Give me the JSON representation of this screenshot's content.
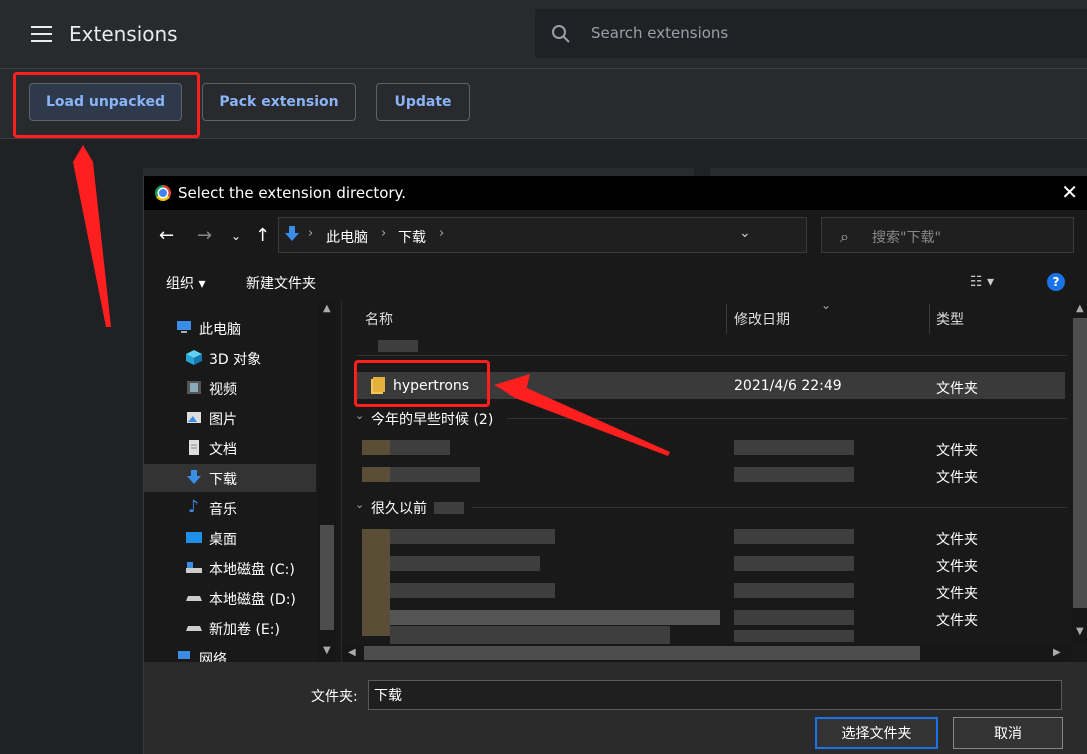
{
  "header": {
    "title": "Extensions",
    "search_placeholder": "Search extensions"
  },
  "toolbar": {
    "load_unpacked": "Load unpacked",
    "pack_extension": "Pack extension",
    "update": "Update"
  },
  "dialog": {
    "title": "Select the extension directory.",
    "close": "✕",
    "address": {
      "crumbs": [
        "此电脑",
        "下载"
      ]
    },
    "search_placeholder": "搜索\"下载\"",
    "commands": {
      "organize": "组织 ▾",
      "new_folder": "新建文件夹",
      "help": "?"
    },
    "nav_tree": [
      {
        "label": "此电脑",
        "icon": "computer-icon"
      },
      {
        "label": "3D 对象",
        "icon": "3d-objects-icon"
      },
      {
        "label": "视频",
        "icon": "video-icon"
      },
      {
        "label": "图片",
        "icon": "pictures-icon"
      },
      {
        "label": "文档",
        "icon": "documents-icon"
      },
      {
        "label": "下载",
        "icon": "download-icon",
        "selected": true
      },
      {
        "label": "音乐",
        "icon": "music-icon"
      },
      {
        "label": "桌面",
        "icon": "desktop-icon"
      },
      {
        "label": "本地磁盘 (C:)",
        "icon": "drive-c-icon"
      },
      {
        "label": "本地磁盘 (D:)",
        "icon": "drive-d-icon"
      },
      {
        "label": "新加卷 (E:)",
        "icon": "drive-e-icon"
      },
      {
        "label": "网络",
        "icon": "network-icon"
      }
    ],
    "columns": {
      "name": "名称",
      "modified": "修改日期",
      "type": "类型"
    },
    "selected_item": {
      "name": "hypertrons",
      "modified": "2021/4/6 22:49",
      "type": "文件夹"
    },
    "groups": {
      "earlier_this_year": "今年的早些时候 (2)",
      "long_ago": "很久以前"
    },
    "row_types": [
      "文件夹",
      "文件夹",
      "文件夹",
      "文件夹",
      "文件夹",
      "文件夹"
    ],
    "footer": {
      "folder_label": "文件夹:",
      "folder_value": "下载",
      "select_button": "选择文件夹",
      "cancel_button": "取消"
    }
  },
  "annotation_color": "#ff1f1f"
}
